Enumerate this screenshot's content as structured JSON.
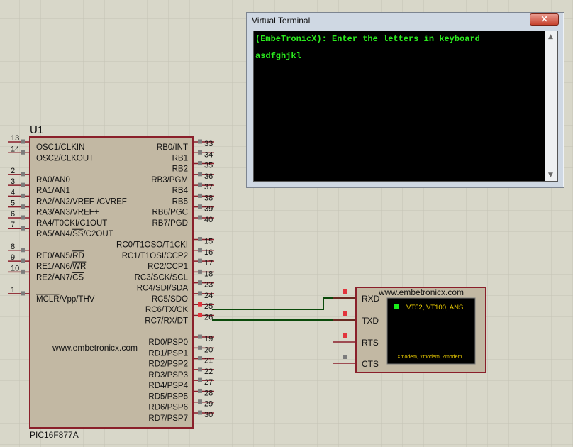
{
  "terminal": {
    "title": "Virtual Terminal",
    "close_glyph": "✕",
    "lines": [
      "(EmbeTronicX): Enter the letters in keyboard",
      "asdfghjkl"
    ],
    "scroll_up_glyph": "▲",
    "scroll_down_glyph": "▼"
  },
  "mcu": {
    "ref": "U1",
    "part": "PIC16F877A",
    "watermark": "www.embetronicx.com",
    "left_pins": [
      {
        "num": "13",
        "label": "OSC1/CLKIN"
      },
      {
        "num": "14",
        "label": "OSC2/CLKOUT"
      },
      {
        "num": "2",
        "label": "RA0/AN0"
      },
      {
        "num": "3",
        "label": "RA1/AN1"
      },
      {
        "num": "4",
        "label": "RA2/AN2/VREF-/CVREF"
      },
      {
        "num": "5",
        "label": "RA3/AN3/VREF+"
      },
      {
        "num": "6",
        "label": "RA4/T0CKI/C1OUT"
      },
      {
        "num": "7",
        "label": "RA5/AN4/SS/C2OUT"
      },
      {
        "num": "8",
        "label": "RE0/AN5/RD"
      },
      {
        "num": "9",
        "label": "RE1/AN6/WR"
      },
      {
        "num": "10",
        "label": "RE2/AN7/CS"
      },
      {
        "num": "1",
        "label": "MCLR/Vpp/THV"
      }
    ],
    "right_pins": [
      {
        "num": "33",
        "label": "RB0/INT"
      },
      {
        "num": "34",
        "label": "RB1"
      },
      {
        "num": "35",
        "label": "RB2"
      },
      {
        "num": "36",
        "label": "RB3/PGM"
      },
      {
        "num": "37",
        "label": "RB4"
      },
      {
        "num": "38",
        "label": "RB5"
      },
      {
        "num": "39",
        "label": "RB6/PGC"
      },
      {
        "num": "40",
        "label": "RB7/PGD"
      },
      {
        "num": "15",
        "label": "RC0/T1OSO/T1CKI"
      },
      {
        "num": "16",
        "label": "RC1/T1OSI/CCP2"
      },
      {
        "num": "17",
        "label": "RC2/CCP1"
      },
      {
        "num": "18",
        "label": "RC3/SCK/SCL"
      },
      {
        "num": "23",
        "label": "RC4/SDI/SDA"
      },
      {
        "num": "24",
        "label": "RC5/SDO"
      },
      {
        "num": "25",
        "label": "RC6/TX/CK"
      },
      {
        "num": "26",
        "label": "RC7/RX/DT"
      },
      {
        "num": "19",
        "label": "RD0/PSP0"
      },
      {
        "num": "20",
        "label": "RD1/PSP1"
      },
      {
        "num": "21",
        "label": "RD2/PSP2"
      },
      {
        "num": "22",
        "label": "RD3/PSP3"
      },
      {
        "num": "27",
        "label": "RD4/PSP4"
      },
      {
        "num": "28",
        "label": "RD5/PSP5"
      },
      {
        "num": "29",
        "label": "RD6/PSP6"
      },
      {
        "num": "30",
        "label": "RD7/PSP7"
      }
    ]
  },
  "vterm_component": {
    "watermark": "www.embetronicx.com",
    "pins": [
      "RXD",
      "TXD",
      "RTS",
      "CTS"
    ],
    "modes": "VT52, VT100, ANSI",
    "protocols": "Xmodem, Ymodem, Zmodem"
  },
  "colors": {
    "grid_bg": "#d8d7c9",
    "grid_line": "#c4c3b5",
    "body_fill": "#c2b8a3",
    "body_stroke": "#8a1f2a",
    "wire": "#0b4a0b",
    "pin_active": "#e3343c",
    "pin_idle": "#7c7c7c",
    "terminal_text": "#2bea1e"
  }
}
